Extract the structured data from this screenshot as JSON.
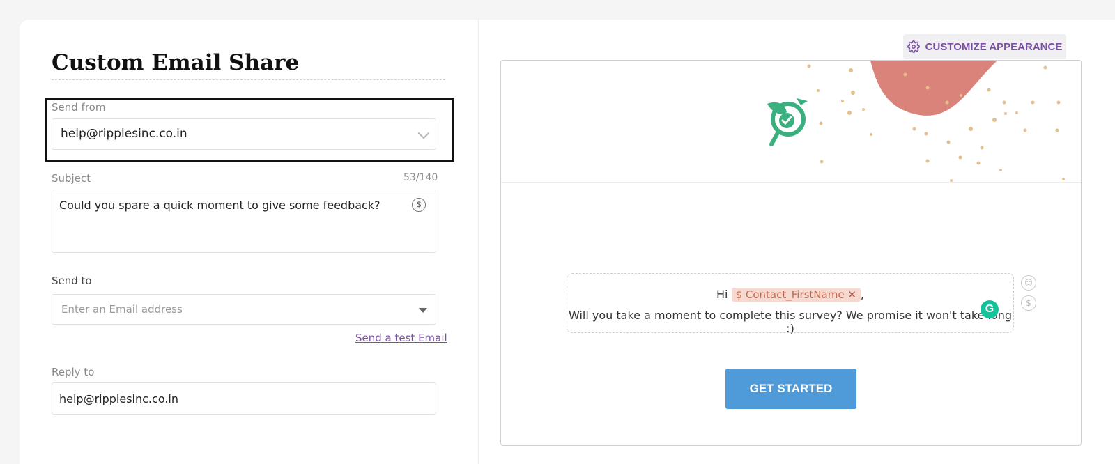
{
  "form": {
    "title": "Custom Email Share",
    "send_from": {
      "label": "Send from",
      "value": "help@ripplesinc.co.in"
    },
    "subject": {
      "label": "Subject",
      "counter": "53/140",
      "value": "Could you spare a quick moment to give some feedback?"
    },
    "send_to": {
      "label": "Send to",
      "placeholder": "Enter an Email address"
    },
    "test_link": "Send a test Email",
    "reply_to": {
      "label": "Reply to",
      "value": "help@ripplesinc.co.in"
    }
  },
  "preview": {
    "customize_label": "CUSTOMIZE APPEARANCE",
    "greeting": "Hi",
    "token": "Contact_FirstName",
    "token_prefix": "$",
    "comma": ",",
    "message": "Will you take a moment to complete this survey? We promise it won't take long :)",
    "cta_label": "GET STARTED",
    "colors": {
      "accent": "#7b4fa6",
      "button": "#4f9bd9",
      "logo": "#3ab07f",
      "blob": "#d9837a",
      "dots": "#e3c08d"
    }
  },
  "icons": {
    "gear": "gear-icon",
    "dollar": "dollar-icon",
    "emoji": "smiley-icon",
    "grammarly": "grammarly-icon"
  },
  "dollar_symbol": "$",
  "grammarly_letter": "G"
}
